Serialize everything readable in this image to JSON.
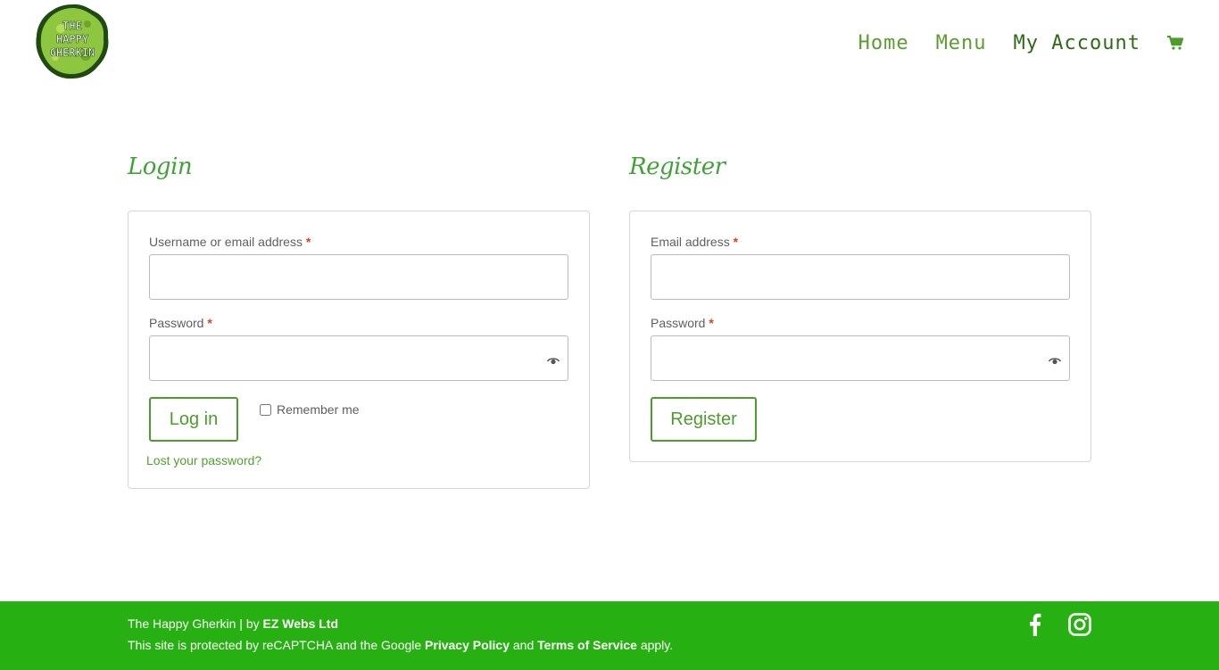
{
  "header": {
    "logo_text": "THE HAPPY GHERKIN",
    "nav": [
      {
        "label": "Home"
      },
      {
        "label": "Menu"
      },
      {
        "label": "My Account"
      }
    ]
  },
  "login": {
    "title": "Login",
    "username_label": "Username or email address",
    "username_value": "",
    "password_label": "Password",
    "password_value": "",
    "required_mark": "*",
    "submit_label": "Log in",
    "remember_label": "Remember me",
    "remember_checked": false,
    "lost_password": "Lost your password?"
  },
  "register": {
    "title": "Register",
    "email_label": "Email address",
    "email_value": "",
    "password_label": "Password",
    "password_value": "",
    "required_mark": "*",
    "submit_label": "Register"
  },
  "footer": {
    "site_name": "The Happy Gherkin",
    "separator": " | by ",
    "credit": "EZ Webs Ltd",
    "recaptcha_prefix": "This site is protected by reCAPTCHA and the Google ",
    "privacy_link": "Privacy Policy",
    "and_text": " and ",
    "terms_link": "Terms of Service",
    "apply_text": " apply.",
    "social": [
      "facebook-icon",
      "instagram-icon"
    ]
  },
  "colors": {
    "brand_green": "#27b012",
    "accent_green": "#4b9e2a",
    "required_red": "#e2401c"
  }
}
